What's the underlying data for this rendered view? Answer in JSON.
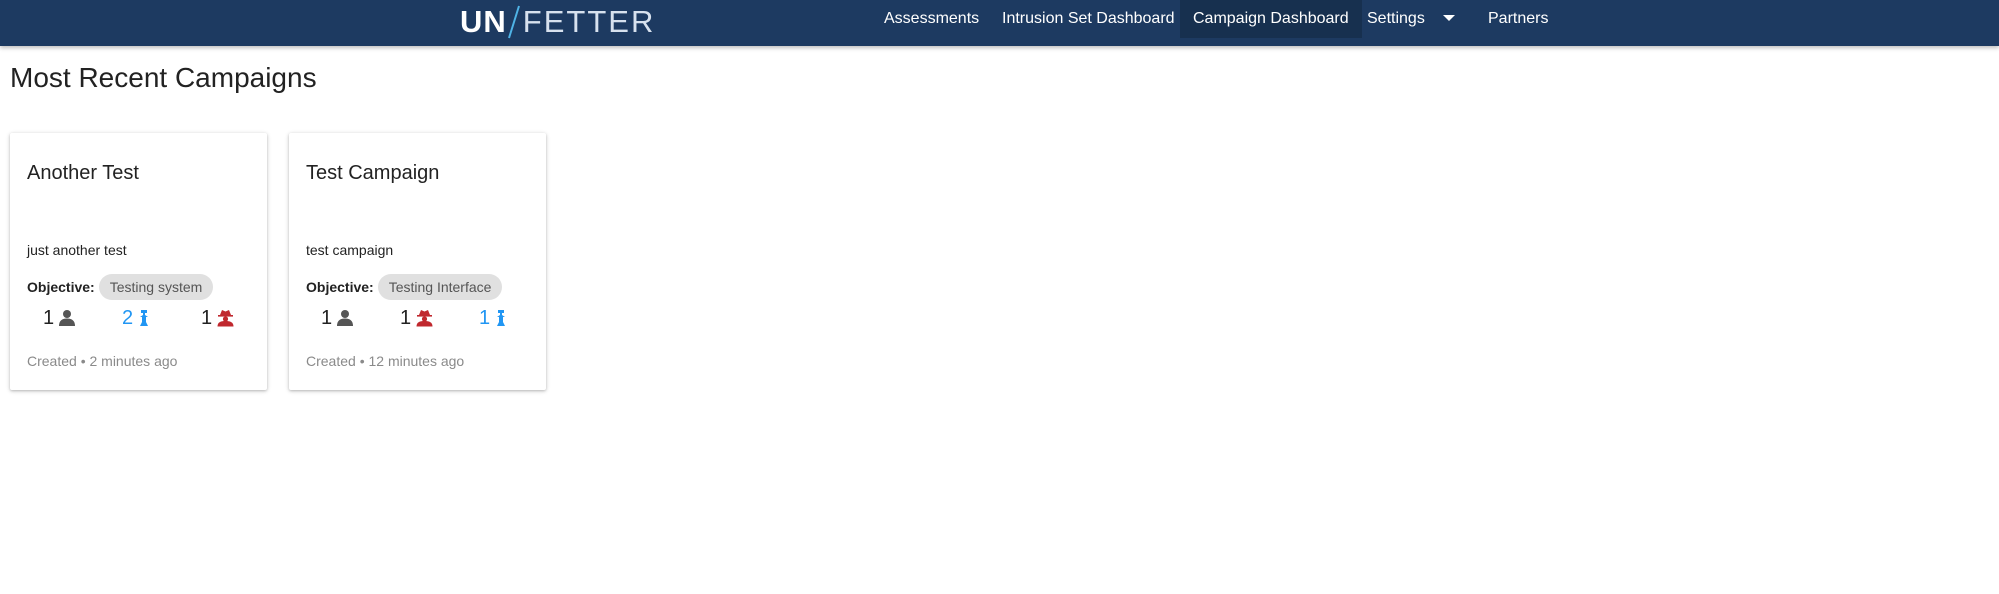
{
  "app": {
    "logo_left": "UN",
    "logo_right": "FETTER"
  },
  "nav": {
    "assessments": "Assessments",
    "intrusion_set_dashboard": "Intrusion Set Dashboard",
    "campaign_dashboard": "Campaign Dashboard",
    "settings": "Settings",
    "partners": "Partners",
    "active": "Campaign Dashboard"
  },
  "page": {
    "title": "Most Recent Campaigns"
  },
  "objective_label": "Objective:",
  "cards": [
    {
      "title": "Another Test",
      "description": "just another test",
      "objective": "Testing system",
      "stats": [
        {
          "value": "1",
          "icon": "person-icon",
          "color": "#555555"
        },
        {
          "value": "2",
          "icon": "pawn-icon",
          "color": "#2196f3"
        },
        {
          "value": "1",
          "icon": "spy-icon",
          "color": "#c0282e"
        }
      ],
      "created": "Created • 2 minutes ago"
    },
    {
      "title": "Test Campaign",
      "description": "test campaign",
      "objective": "Testing Interface",
      "stats": [
        {
          "value": "1",
          "icon": "person-icon",
          "color": "#555555"
        },
        {
          "value": "1",
          "icon": "spy-icon",
          "color": "#c0282e"
        },
        {
          "value": "1",
          "icon": "pawn-icon",
          "color": "#2196f3"
        }
      ],
      "created": "Created • 12 minutes ago"
    }
  ]
}
